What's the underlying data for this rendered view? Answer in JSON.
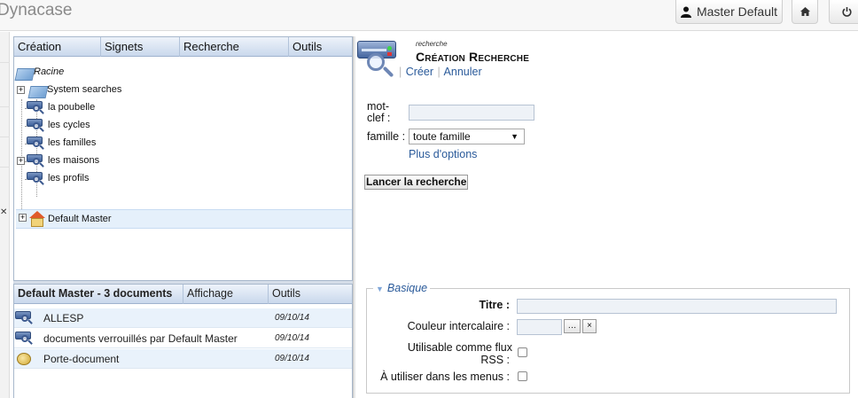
{
  "app": {
    "title": "Dynacase"
  },
  "header": {
    "user_label": "Master Default",
    "user_icon": "user-icon",
    "home_icon": "home-icon",
    "power_icon": "power-icon"
  },
  "tree_panel": {
    "menu": [
      "Création",
      "Signets",
      "Recherche",
      "Outils"
    ],
    "nodes": [
      {
        "label": "Racine",
        "icon": "folder-icon"
      },
      {
        "label": "System searches",
        "icon": "folder-icon"
      },
      {
        "label": "la poubelle",
        "icon": "search-icon"
      },
      {
        "label": "les cycles",
        "icon": "search-icon"
      },
      {
        "label": "les familles",
        "icon": "search-icon"
      },
      {
        "label": "les maisons",
        "icon": "search-icon"
      },
      {
        "label": "les profils",
        "icon": "search-icon"
      },
      {
        "label": "Default Master",
        "icon": "house-icon"
      }
    ]
  },
  "doc_list": {
    "headers": [
      "Default Master - 3 documents",
      "Affichage",
      "Outils"
    ],
    "rows": [
      {
        "title": "ALLESP",
        "date": "09/10/14",
        "icon": "search-icon"
      },
      {
        "title": "documents verrouillés par Default Master",
        "date": "09/10/14",
        "icon": "search-icon"
      },
      {
        "title": "Porte-document",
        "date": "09/10/14",
        "icon": "briefcase-icon"
      }
    ]
  },
  "form": {
    "subtitle": "recherche",
    "title": "Création Recherche",
    "create_link": "Créer",
    "cancel_link": "Annuler",
    "keyword_label_1": "mot-",
    "keyword_label_2": "clef :",
    "keyword_value": "",
    "family_label": "famille :",
    "family_value": "toute famille",
    "more_options": "Plus d'options",
    "launch_button": "Lancer la recherche",
    "section_title": "Basique",
    "fields": {
      "title_label": "Titre :",
      "title_value": "",
      "color_label": "Couleur intercalaire :",
      "color_value": "",
      "color_pick": "…",
      "color_clear": "×",
      "rss_label_1": "Utilisable comme flux",
      "rss_label_2": "RSS :",
      "rss_checked": false,
      "menus_label": "À utiliser dans les menus :",
      "menus_checked": false
    }
  }
}
